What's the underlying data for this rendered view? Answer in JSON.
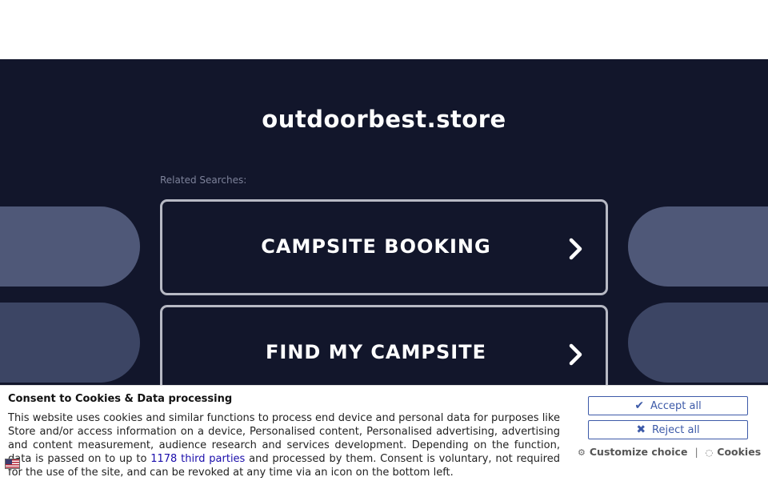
{
  "page": {
    "site_title": "outdoorbest.store",
    "related_label": "Related Searches:",
    "searches": [
      {
        "label": "CAMPSITE BOOKING"
      },
      {
        "label": "FIND MY CAMPSITE"
      }
    ]
  },
  "consent": {
    "title": "Consent to Cookies & Data processing",
    "text_before": "This website uses cookies and similar functions to process end device and personal data for purposes like Store and/or access information on a device, Personalised content, Personalised advertising, advertising and content measurement, audience research and services development. Depending on the function, data is passed on to up to ",
    "link_text": "1178 third parties",
    "text_after": " and processed by them. Consent is voluntary, not required for the use of the site, and can be revoked at any time via an icon on the bottom left.",
    "accept_label": "Accept all",
    "reject_label": "Reject all",
    "customize_label": "Customize choice",
    "separator": "|",
    "cookies_label": "Cookies"
  },
  "colors": {
    "background": "#12162b",
    "button_border": "#b7b9c4",
    "consent_accent": "#3d5aa8",
    "link": "#1a0dab"
  },
  "icons": [
    "chevron-right-icon",
    "check-icon",
    "x-icon",
    "gear-icon",
    "cookie-icon",
    "flag-icon"
  ]
}
